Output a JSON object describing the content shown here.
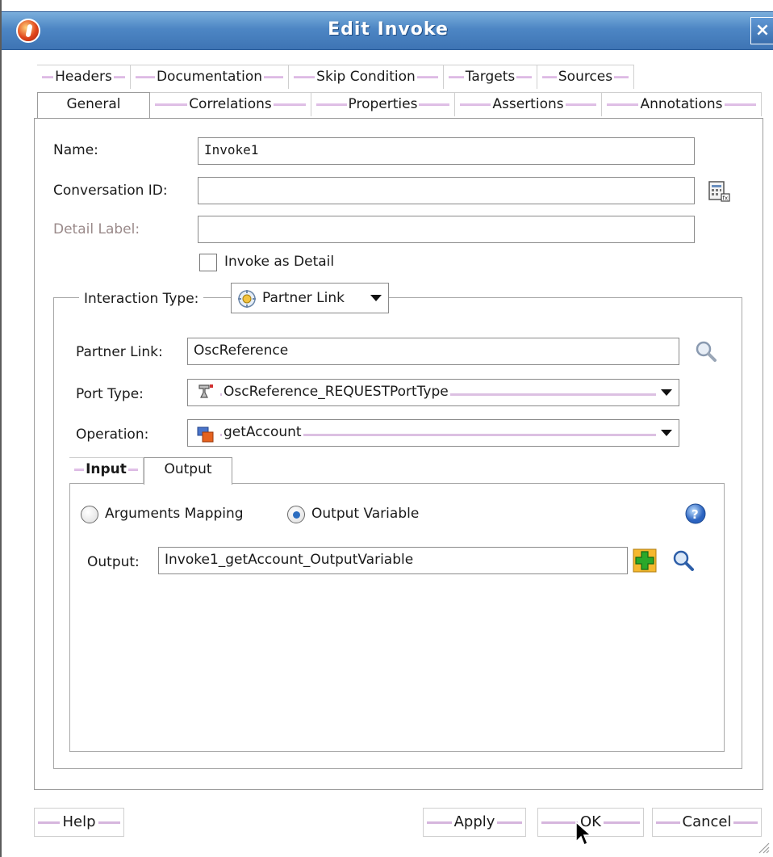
{
  "window": {
    "title": "Edit Invoke",
    "close_label": "×"
  },
  "tabs_row1": [
    "Headers",
    "Documentation",
    "Skip Condition",
    "Targets",
    "Sources"
  ],
  "tabs_row2": [
    "General",
    "Correlations",
    "Properties",
    "Assertions",
    "Annotations"
  ],
  "selected_tab": "General",
  "form": {
    "name_label": "Name:",
    "name_value": "Invoke1",
    "conversation_label": "Conversation ID:",
    "conversation_value": "",
    "detail_label_label": "Detail Label:",
    "detail_label_value": "",
    "invoke_as_detail_label": "Invoke as Detail",
    "invoke_as_detail_checked": false
  },
  "interaction": {
    "type_label": "Interaction Type:",
    "type_value": "Partner Link",
    "partner_link_label": "Partner Link:",
    "partner_link_value": "OscReference",
    "port_type_label": "Port Type:",
    "port_type_value": "OscReference_REQUESTPortType",
    "operation_label": "Operation:",
    "operation_value": "getAccount"
  },
  "io_tabs": [
    "Input",
    "Output"
  ],
  "io_selected": "Output",
  "output": {
    "radio_args_label": "Arguments Mapping",
    "radio_var_label": "Output Variable",
    "selected_radio": "Output Variable",
    "output_label": "Output:",
    "output_value": "Invoke1_getAccount_OutputVariable"
  },
  "buttons": {
    "help": "Help",
    "apply": "Apply",
    "ok": "OK",
    "cancel": "Cancel"
  },
  "colors": {
    "titlebar": "#4d86c4",
    "tab_accent": "#d8b3e0",
    "add_icon": "#2aa82a"
  }
}
